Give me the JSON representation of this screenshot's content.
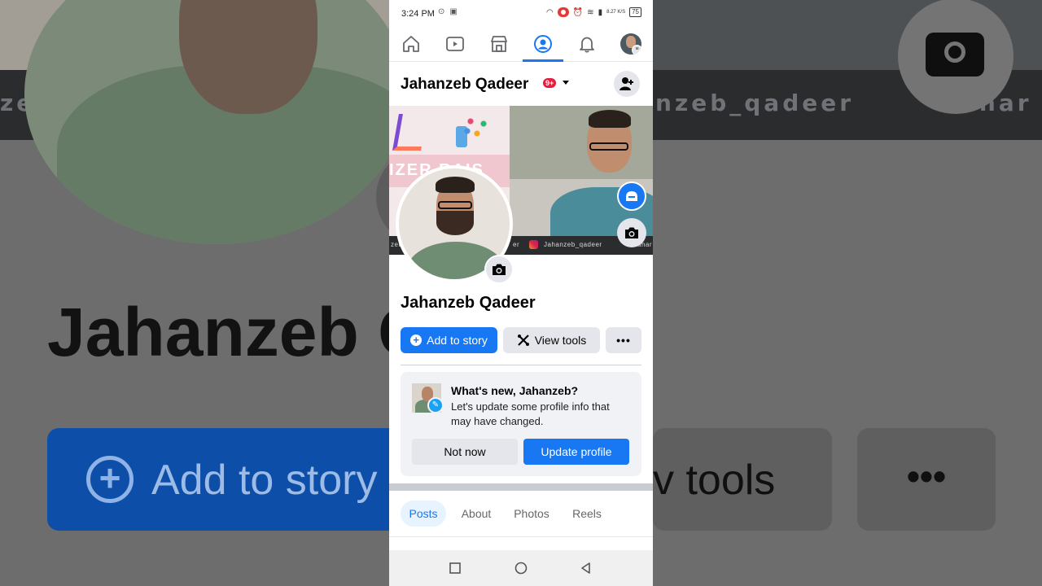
{
  "background": {
    "strip_text_1": "nzeb_qadeer",
    "strip_text_2": "zeb",
    "strip_text_3": "ahar",
    "name": "Jahanzeb Q",
    "add_to_story": "Add to story",
    "view_tools": "v tools",
    "more": "•••"
  },
  "status_bar": {
    "time": "3:24 PM",
    "speed": "8.27 K/S",
    "battery": "75"
  },
  "nav": {
    "items": [
      "home-icon",
      "video-icon",
      "marketplace-icon",
      "profile-icon",
      "bell-icon",
      "menu-avatar"
    ],
    "active": "profile-icon"
  },
  "profile_header": {
    "name": "Jahanzeb Qadeer",
    "badge": "9+"
  },
  "cover": {
    "left_text": "IZER RAIS",
    "strip_left": "zet",
    "strip_mid": "er",
    "handle": "Jahanzeb_qadeer",
    "strip_right": "ahar"
  },
  "profile": {
    "name": "Jahanzeb Qadeer"
  },
  "actions": {
    "add_to_story": "Add to story",
    "view_tools": "View tools",
    "more": "•••"
  },
  "card": {
    "title": "What's new, Jahanzeb?",
    "description": "Let's update some profile info that may have changed.",
    "not_now": "Not now",
    "update": "Update profile"
  },
  "tabs": [
    {
      "label": "Posts",
      "active": true
    },
    {
      "label": "About",
      "active": false
    },
    {
      "label": "Photos",
      "active": false
    },
    {
      "label": "Reels",
      "active": false
    }
  ],
  "colors": {
    "accent": "#1877f2",
    "badge": "#e41e3f"
  }
}
